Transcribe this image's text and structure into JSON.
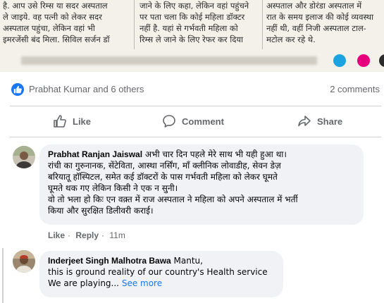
{
  "clipping": {
    "col1": "है. आप उसे रिम्स या सदर अस्पताल\nले जाइये. वह पत्नी को लेकर सदर\nअस्पताल पहुंचा, लेकिन वहां भी\nइमरजेंसी बंद मिला. सिविल सर्जन डॉ",
    "col2": "जाने के लिए कहा, लेकिन वहां पहुंचने\nपर पता चला कि कोई महिला डॉक्टर\nनहीं है. यहां से गर्भवती महिला को\nरिम्स ले जाने के लिए रेफर कर दिया",
    "col3": "अस्पताल और डोरंडा अस्पताल में\nरात के समय इलाज की कोई व्यवस्था\nनहीं थी, वहीं निजी अस्पताल टाल-\nमटोल कर रहे थे.",
    "dot_colors": [
      "#1aa3e0",
      "#e6007e",
      "#2b2b2b"
    ]
  },
  "reactions": {
    "summary": "Prabhat Kumar and 6 others",
    "comments_count": "2 comments"
  },
  "actions": {
    "like": "Like",
    "comment": "Comment",
    "share": "Share"
  },
  "comments": [
    {
      "author": "Prabhat Ranjan Jaiswal",
      "text": " अभी चार दिन पहले मेरे साथ भी यही हुआ था।\nरांची का गुरुनानक, सेंटेविता, आस्था नर्सिंग, माँ क्लीनिक लोवाडीह, सेवन डेज़\nबरियातू हॉस्पिटल, समेत कई डॉक्टरों के पास गर्भवती महिला को लेकर घूमते\nघूमते थक गए लेकिन किसी ने एक न सुनी।\nवो तो भला हो किः एन वक़्त में राज अस्पताल ने महिला को अपने अस्पताल में भर्ती\nकिया और सुरक्षित डिलीवरी कराई।",
      "like": "Like",
      "reply": "Reply",
      "time": "11m"
    },
    {
      "author": "Inderjeet Singh Malhotra Bawa",
      "mention": " Mantu,",
      "line2": "this is ground reality of our country's Health service",
      "line3": "We are playing...",
      "see_more": "See more"
    }
  ],
  "colors": {
    "accent": "#1877f2",
    "muted": "#65676b",
    "bubble": "#f0f2f5"
  }
}
